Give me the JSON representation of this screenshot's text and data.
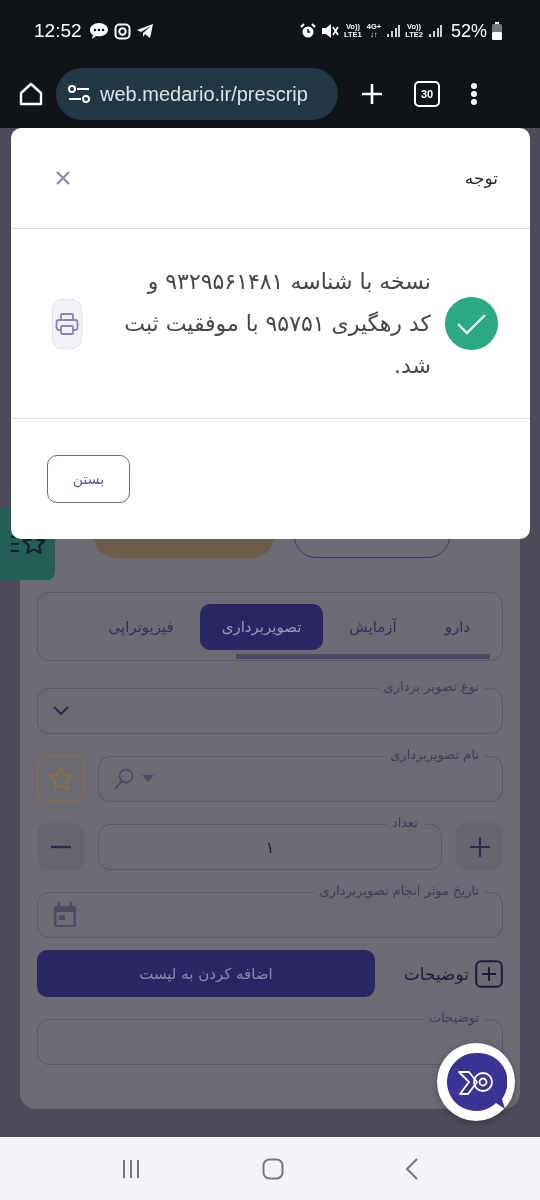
{
  "status_bar": {
    "time": "12:52",
    "sim1": [
      "Vo))",
      "LTE1"
    ],
    "network": [
      "4G+",
      "↓↑"
    ],
    "sim2": [
      "Vo))",
      "LTE2"
    ],
    "battery": "52%"
  },
  "browser": {
    "url": "web.medario.ir/prescrip",
    "tab_count": "30"
  },
  "dialog": {
    "title": "توجه",
    "message": "نسخه با شناسه ۹۳۲۹۵۶۱۴۸۱ و کد رهگیری ۹۵۷۵۱ با موفقیت ثبت شد.",
    "close_button": "بستن"
  },
  "page": {
    "tabs": [
      {
        "label": "دارو",
        "selected": false
      },
      {
        "label": "آزمایش",
        "selected": false
      },
      {
        "label": "تصویربرداری",
        "selected": true
      },
      {
        "label": "فیزیوتراپی",
        "selected": false
      }
    ],
    "fields": [
      {
        "kind": "select",
        "label": "نوع تصویر برداری"
      },
      {
        "kind": "search",
        "label": "نام تصویربرداری"
      },
      {
        "kind": "counter",
        "label": "تعداد",
        "value": "۱"
      },
      {
        "kind": "date",
        "label": "تاریخ موثر انجام تصویربرداری"
      }
    ],
    "add_button": "اضافه کردن به لیست",
    "notes_toggle": "توضیحات",
    "notes_field": {
      "label": "توضیحات"
    }
  }
}
